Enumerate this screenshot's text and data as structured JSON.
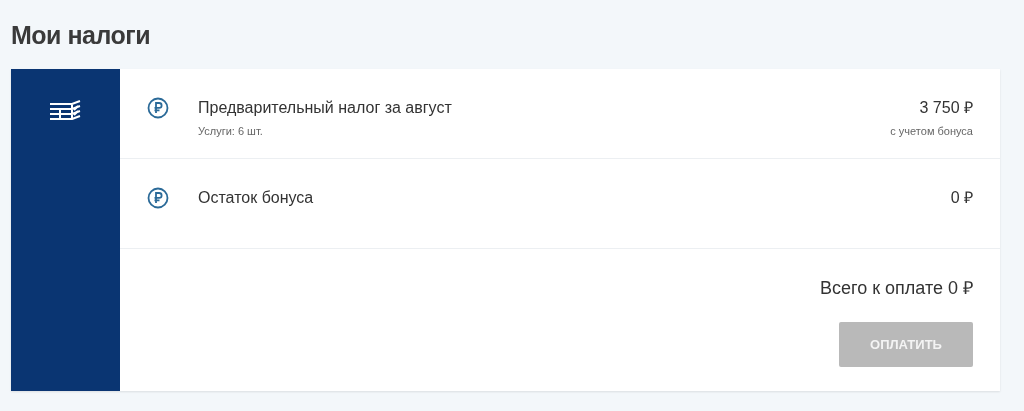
{
  "title": "Мои налоги",
  "rows": [
    {
      "name": "Предварительный налог за август",
      "subtitle": "Услуги: 6 шт.",
      "amount": "3 750 ₽",
      "amount_note": "с учетом бонуса"
    },
    {
      "name": "Остаток бонуса",
      "amount": "0 ₽"
    }
  ],
  "total": "Всего к оплате 0 ₽",
  "pay_button": {
    "label": "ОПЛАТИТЬ",
    "disabled": true
  }
}
